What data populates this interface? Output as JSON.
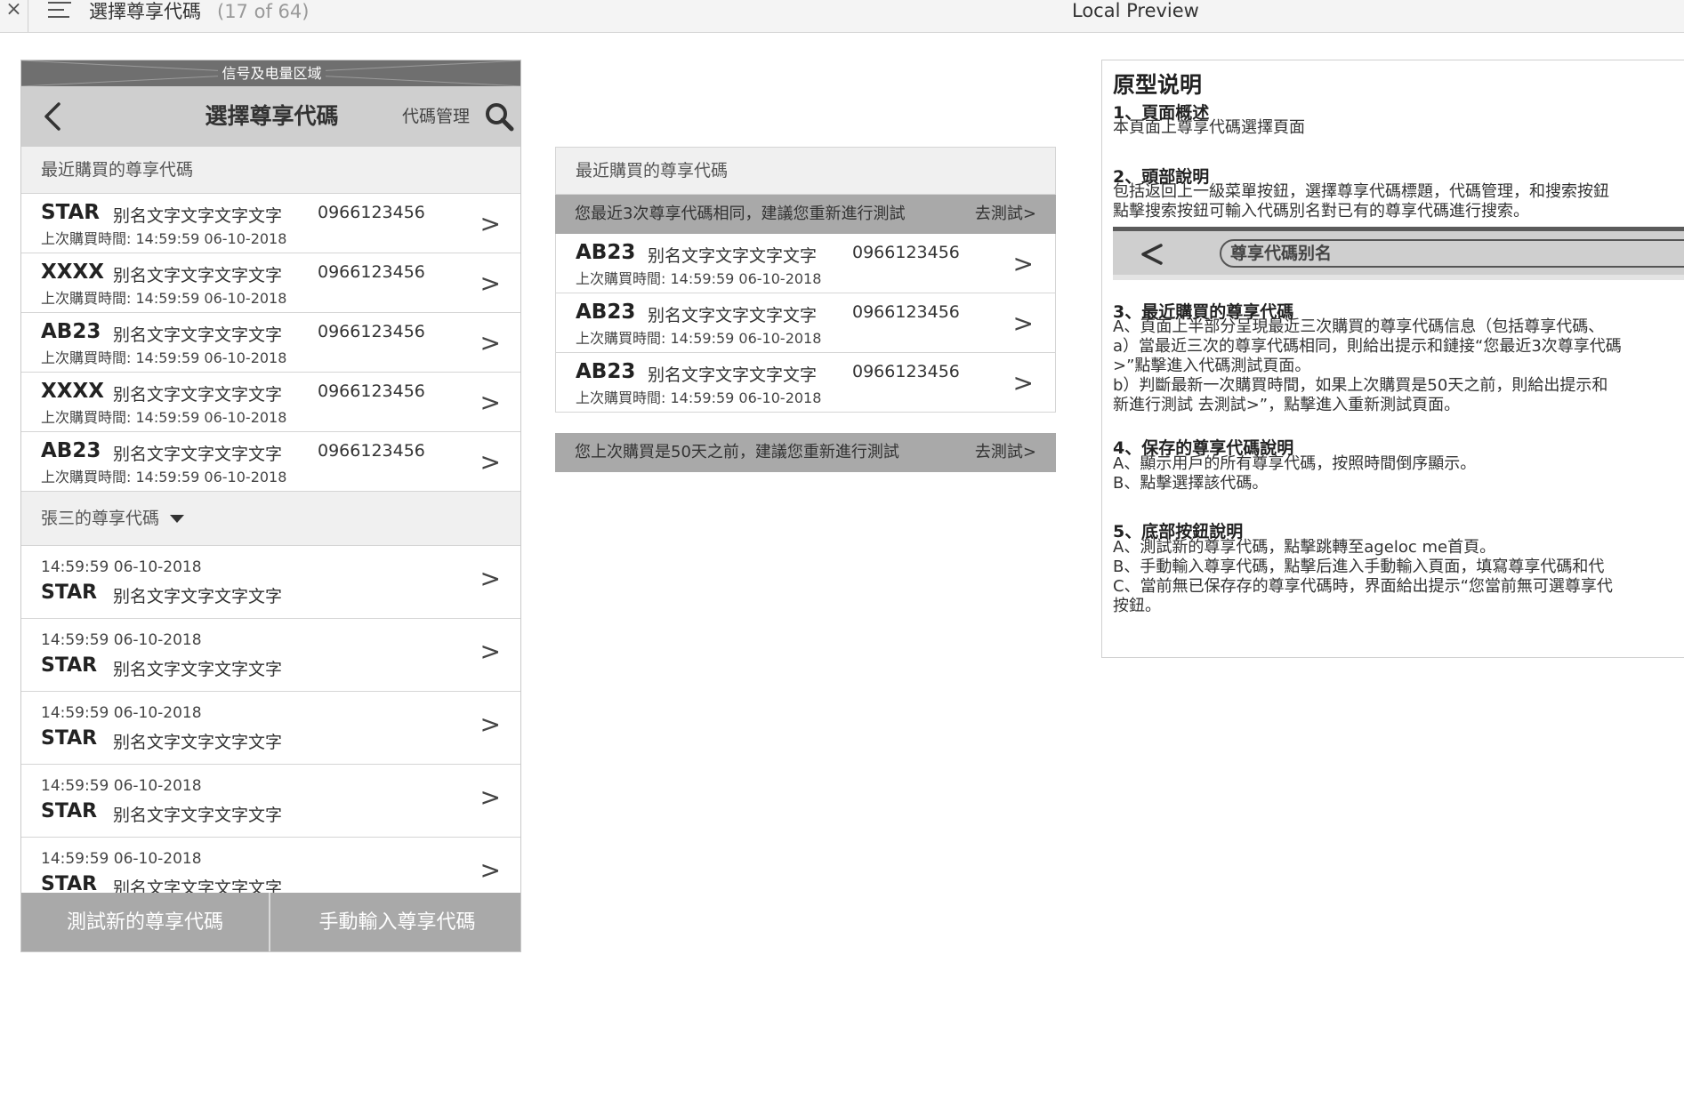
{
  "window": {
    "close_glyph": "×",
    "title": "選擇尊享代碼",
    "count": "(17 of 64)",
    "center_title": "Local Preview"
  },
  "phone": {
    "status_label": "信号及电量区域",
    "header": {
      "title": "選擇尊享代碼",
      "manage_label": "代碼管理"
    },
    "recent_section_label": "最近購買的尊享代碼",
    "recent_rows": [
      {
        "code": "STAR",
        "alias": "别名文字文字文字文字",
        "phone": "0966123456",
        "time": "上次購買時間:  14:59:59 06-10-2018"
      },
      {
        "code": "XXXX",
        "alias": "别名文字文字文字文字",
        "phone": "0966123456",
        "time": "上次購買時間:  14:59:59 06-10-2018"
      },
      {
        "code": "AB23",
        "alias": "别名文字文字文字文字",
        "phone": "0966123456",
        "time": "上次購買時間:  14:59:59 06-10-2018"
      },
      {
        "code": "XXXX",
        "alias": "别名文字文字文字文字",
        "phone": "0966123456",
        "time": "上次購買時間:  14:59:59 06-10-2018"
      },
      {
        "code": "AB23",
        "alias": "别名文字文字文字文字",
        "phone": "0966123456",
        "time": "上次購買時間:  14:59:59 06-10-2018"
      }
    ],
    "saved_section_label": "張三的尊享代碼",
    "saved_rows": [
      {
        "timestamp": "14:59:59 06-10-2018",
        "code": "STAR",
        "alias": "别名文字文字文字文字"
      },
      {
        "timestamp": "14:59:59 06-10-2018",
        "code": "STAR",
        "alias": "别名文字文字文字文字"
      },
      {
        "timestamp": "14:59:59 06-10-2018",
        "code": "STAR",
        "alias": "别名文字文字文字文字"
      },
      {
        "timestamp": "14:59:59 06-10-2018",
        "code": "STAR",
        "alias": "别名文字文字文字文字"
      },
      {
        "timestamp": "14:59:59 06-10-2018",
        "code": "STAR",
        "alias": "别名文字文字文字文字"
      }
    ],
    "chevron": ">",
    "bottom": {
      "left_label": "測試新的尊享代碼",
      "right_label": "手動輸入尊享代碼"
    }
  },
  "middle": {
    "section_label": "最近購買的尊享代碼",
    "alert_top": {
      "text": "您最近3次尊享代碼相同，建議您重新進行測試",
      "go": "去測試>"
    },
    "rows": [
      {
        "code": "AB23",
        "alias": "别名文字文字文字文字",
        "phone": "0966123456",
        "time": "上次購買時間:  14:59:59 06-10-2018"
      },
      {
        "code": "AB23",
        "alias": "别名文字文字文字文字",
        "phone": "0966123456",
        "time": "上次購買時間:  14:59:59 06-10-2018"
      },
      {
        "code": "AB23",
        "alias": "别名文字文字文字文字",
        "phone": "0966123456",
        "time": "上次購買時間:  14:59:59 06-10-2018"
      }
    ],
    "alert_bottom": {
      "text": "您上次購買是50天之前，建議您重新進行測試",
      "go": "去測試>"
    }
  },
  "notes": {
    "title": "原型说明",
    "s1_head": "1、頁面概述",
    "s1_l1": "本頁面上尊享代碼選擇頁面",
    "s2_head": "2、頭部說明",
    "s2_l1": "包括返回上一級菜單按鈕，選擇尊享代碼標題，代碼管理，和搜索按鈕",
    "s2_l2": "點擊搜索按鈕可輸入代碼別名對已有的尊享代碼進行搜索。",
    "search_mock_placeholder": "尊享代碼别名",
    "s3_head": "3、最近購買的尊享代碼",
    "s3_l1": "A、頁面上半部分呈現最近三次購買的尊享代碼信息（包括尊享代碼、",
    "s3_l2": "a）當最近三次的尊享代碼相同，則給出提示和鏈接“您最近3次尊享代碼",
    "s3_l3": ">”點擊進入代碼測試頁面。",
    "s3_l4": "b）判斷最新一次購買時間，如果上次購買是50天之前，則給出提示和",
    "s3_l5": "新進行測試   去測試>”，點擊進入重新測試頁面。",
    "s4_head": "4、保存的尊享代碼說明",
    "s4_l1": "A、顯示用戶的所有尊享代碼，按照時間倒序顯示。",
    "s4_l2": "B、點擊選擇該代碼。",
    "s5_head": "5、底部按鈕說明",
    "s5_l1": "A、測試新的尊享代碼，點擊跳轉至ageloc me首頁。",
    "s5_l2": "B、手動輸入尊享代碼，點擊后進入手動輸入頁面，填寫尊享代碼和代",
    "s5_l3": "C、當前無已保存存的尊享代碼時，界面給出提示“您當前無可選尊享代",
    "s5_l4": "按鈕。"
  }
}
